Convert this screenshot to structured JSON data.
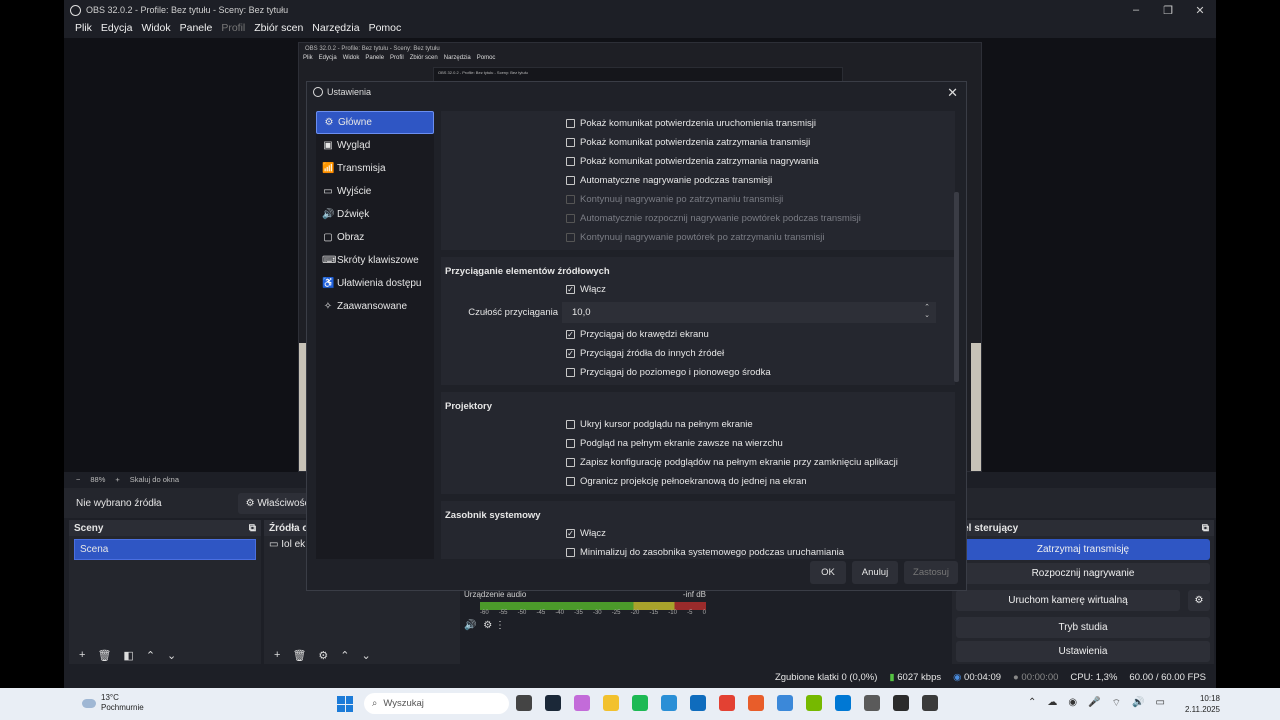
{
  "window": {
    "title": "OBS 32.0.2 - Profile: Bez tytułu - Sceny: Bez tytułu",
    "controls": [
      "–",
      "❐",
      "✕"
    ]
  },
  "menu": [
    "Plik",
    "Edycja",
    "Widok",
    "Panele",
    "Profil",
    "Zbiór scen",
    "Narzędzia",
    "Pomoc"
  ],
  "nested_preview": {
    "title": "OBS 32.0.2 - Profile: Bez tytułu - Sceny: Bez tytułu",
    "menu": [
      "Plik",
      "Edycja",
      "Widok",
      "Panele",
      "Profil",
      "Zbiór scen",
      "Narzędzia",
      "Pomoc"
    ]
  },
  "zoom": {
    "minus": "−",
    "value": "88%",
    "plus": "+",
    "fit": "Skaluj do okna"
  },
  "source_bar": {
    "no_source": "Nie wybrano źródła",
    "properties": "Właściwości"
  },
  "scenes": {
    "title": "Sceny",
    "items": [
      "Scena"
    ]
  },
  "sources": {
    "title": "Źródła o",
    "items": [
      "Iol ek"
    ]
  },
  "audio": {
    "device": "Urządzenie audio",
    "level": "-inf dB",
    "ticks": [
      "-60",
      "-55",
      "-50",
      "-45",
      "-40",
      "-35",
      "-30",
      "-25",
      "-20",
      "-15",
      "-10",
      "-5",
      "0"
    ]
  },
  "controls_dock": {
    "title": "nel sterujący",
    "buttons": [
      "Zatrzymaj transmisję",
      "Rozpocznij nagrywanie",
      "Uruchom kamerę wirtualną",
      "Tryb studia",
      "Ustawienia"
    ]
  },
  "status": {
    "dropped": "Zgubione klatki 0 (0,0%)",
    "bitrate": "6027 kbps",
    "stream_time": "00:04:09",
    "rec_time": "00:00:00",
    "cpu": "CPU: 1,3%",
    "fps": "60.00 / 60.00 FPS"
  },
  "dialog": {
    "title": "Ustawienia",
    "close": "✕",
    "nav": [
      {
        "label": "Główne",
        "icon": "⚙"
      },
      {
        "label": "Wygląd",
        "icon": "▣"
      },
      {
        "label": "Transmisja",
        "icon": "📶"
      },
      {
        "label": "Wyjście",
        "icon": "▭"
      },
      {
        "label": "Dźwięk",
        "icon": "🔊"
      },
      {
        "label": "Obraz",
        "icon": "▢"
      },
      {
        "label": "Skróty klawiszowe",
        "icon": "⌨"
      },
      {
        "label": "Ułatwienia dostępu",
        "icon": "♿"
      },
      {
        "label": "Zaawansowane",
        "icon": "✧"
      }
    ],
    "stream_opts": [
      {
        "label": "Pokaż komunikat potwierdzenia uruchomienia transmisji",
        "checked": false,
        "disabled": false
      },
      {
        "label": "Pokaż komunikat potwierdzenia zatrzymania transmisji",
        "checked": false,
        "disabled": false
      },
      {
        "label": "Pokaż komunikat potwierdzenia zatrzymania nagrywania",
        "checked": false,
        "disabled": false
      },
      {
        "label": "Automatyczne nagrywanie podczas transmisji",
        "checked": false,
        "disabled": false
      },
      {
        "label": "Kontynuuj nagrywanie po zatrzymaniu transmisji",
        "checked": false,
        "disabled": true
      },
      {
        "label": "Automatycznie rozpocznij nagrywanie powtórek podczas transmisji",
        "checked": false,
        "disabled": true
      },
      {
        "label": "Kontynuuj nagrywanie powtórek po zatrzymaniu transmisji",
        "checked": false,
        "disabled": true
      }
    ],
    "snapping": {
      "title": "Przyciąganie elementów źródłowych",
      "enable": "Włącz",
      "sensitivity_label": "Czułość przyciągania",
      "sensitivity_value": "10,0",
      "opts": [
        {
          "label": "Przyciągaj do krawędzi ekranu",
          "checked": true
        },
        {
          "label": "Przyciągaj źródła do innych źródeł",
          "checked": true
        },
        {
          "label": "Przyciągaj do poziomego i pionowego środka",
          "checked": false
        }
      ]
    },
    "projectors": {
      "title": "Projektory",
      "opts": [
        {
          "label": "Ukryj kursor podglądu na pełnym ekranie",
          "checked": false
        },
        {
          "label": "Podgląd na pełnym ekranie zawsze na wierzchu",
          "checked": false
        },
        {
          "label": "Zapisz konfigurację podglądów na pełnym ekranie przy zamknięciu aplikacji",
          "checked": false
        },
        {
          "label": "Ogranicz projekcję pełnoekranową do jednej na ekran",
          "checked": false
        }
      ]
    },
    "tray": {
      "title": "Zasobnik systemowy",
      "opts": [
        {
          "label": "Włącz",
          "checked": true
        },
        {
          "label": "Minimalizuj do zasobnika systemowego podczas uruchamiania",
          "checked": false
        }
      ]
    },
    "buttons": {
      "ok": "OK",
      "cancel": "Anuluj",
      "apply": "Zastosuj"
    }
  },
  "taskbar": {
    "weather_temp": "13°C",
    "weather_desc": "Pochmurnie",
    "search": "Wyszukaj",
    "time": "10:18",
    "date": "2.11.2025",
    "app_colors": [
      "#444444",
      "#1b2838",
      "#c36bd9",
      "#f2c12e",
      "#1db954",
      "#2a8fd6",
      "#0f6cbd",
      "#e34133",
      "#e85d2a",
      "#3b88d9",
      "#76b900",
      "#0078d4",
      "#5a5a5a",
      "#2b2b2b",
      "#3a3a3a"
    ]
  },
  "colors": {
    "accent": "#2f56c4",
    "bg": "#1d1f26",
    "meter_green": "#4b9a2a",
    "meter_red": "#9a2b2b"
  }
}
